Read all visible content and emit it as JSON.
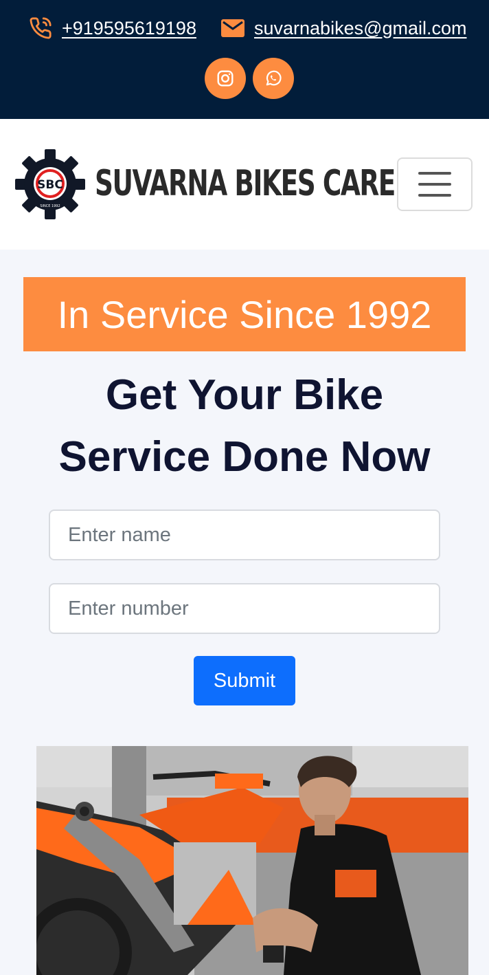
{
  "topbar": {
    "phone": "+919595619198",
    "email": "suvarnabikes@gmail.com",
    "social": [
      {
        "icon": "instagram-icon"
      },
      {
        "icon": "whatsapp-icon"
      }
    ]
  },
  "navbar": {
    "logo_monogram": "SBC",
    "logo_since": "SINCE 1992",
    "brand": "SUVARNA BIKES CARE",
    "toggler_icon": "hamburger-icon"
  },
  "hero": {
    "banner": "In Service Since 1992",
    "headline_line1": "Get Your Bike",
    "headline_line2": "Service Done Now"
  },
  "form": {
    "name_placeholder": "Enter name",
    "number_placeholder": "Enter number",
    "submit_label": "Submit"
  },
  "colors": {
    "topbar_bg": "#021d3a",
    "accent_orange": "#fd8c40",
    "primary_blue": "#0d6efd",
    "headline": "#0f1431"
  }
}
